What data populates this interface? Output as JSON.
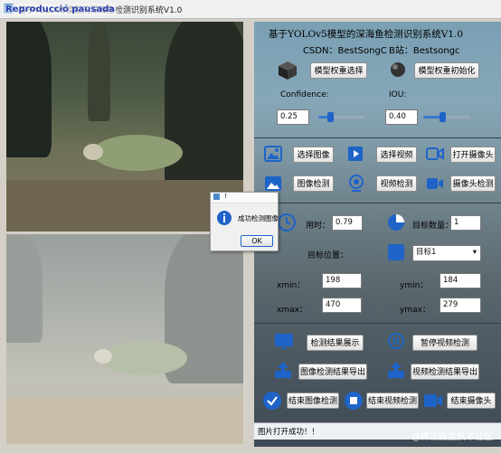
{
  "window": {
    "title": "基于YOLOv5模型的深海鱼检测识别系统V1.0",
    "overlay_label": "Reproducció pausada"
  },
  "header": {
    "title": "基于YOLOv5模型的深海鱼检测识别系统V1.0",
    "csdn": "CSDN：BestSongC",
    "bilibili": "B站：Bestsongc"
  },
  "model": {
    "select_label": "模型权重选择",
    "init_label": "模型权重初始化"
  },
  "params": {
    "confidence_label": "Confidence:",
    "confidence_value": "0.25",
    "confidence_level": 0.25,
    "iou_label": "IOU:",
    "iou_value": "0.40",
    "iou_level": 0.4
  },
  "source": {
    "select_image": "选择图像",
    "select_video": "选择视频",
    "open_camera": "打开摄像头",
    "image_detect": "图像检测",
    "video_detect": "视频检测",
    "camera_detect": "摄像头检测"
  },
  "result": {
    "time_label": "用时：",
    "time_value": "0.79",
    "count_label": "目标数量：",
    "count_value": "1",
    "position_label": "目标位置：",
    "target_select": "目标1",
    "xmin_label": "xmin：",
    "xmin_value": "198",
    "ymin_label": "ymin：",
    "ymin_value": "184",
    "xmax_label": "xmax：",
    "xmax_value": "470",
    "ymax_label": "ymax：",
    "ymax_value": "279"
  },
  "actions": {
    "show_result": "检测结果展示",
    "pause_video": "暂停视频检测",
    "export_image": "图像检测结果导出",
    "export_video": "视频检测结果导出",
    "end_image": "结束图像检测",
    "end_video": "结束视频检测",
    "end_camera": "结束摄像头"
  },
  "dialog": {
    "title": "!",
    "message": "成功检测图像",
    "ok_label": "OK"
  },
  "status": {
    "message": "图片打开成功！！",
    "watermark": "@稀土掘金技术社区"
  },
  "colors": {
    "accent": "#1e64c8",
    "panel_top": "#7a9fb4",
    "panel_bottom": "#3d4a55"
  }
}
